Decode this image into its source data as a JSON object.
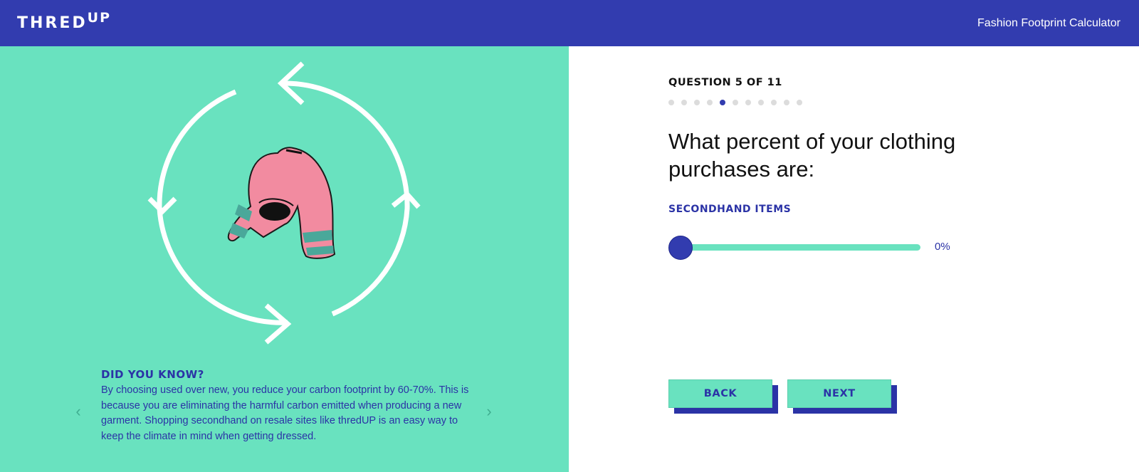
{
  "header": {
    "logo_main": "THRED",
    "logo_super": "UP",
    "app_title": "Fashion Footprint Calculator"
  },
  "colors": {
    "brand_blue": "#323caf",
    "mint": "#69e2bf",
    "sweater_pink": "#f28ba0"
  },
  "illustration": {
    "cycle_arrows": "recycle-cycle-arrows",
    "item": "pink-sweater-illustration"
  },
  "did_you_know": {
    "title": "DID YOU KNOW?",
    "body": "By choosing used over new, you reduce your carbon footprint by 60-70%. This is because you are eliminating the harmful carbon emitted when producing a new garment. Shopping secondhand on resale sites like thredUP is an easy way to keep the climate in mind when getting dressed.",
    "prev_icon": "chevron-left-icon",
    "next_icon": "chevron-right-icon",
    "prev_glyph": "‹",
    "next_glyph": "›"
  },
  "quiz": {
    "counter": "QUESTION 5 OF 11",
    "total_questions": 11,
    "current_question": 5,
    "question": "What percent of your clothing purchases are:",
    "section_label": "SECONDHAND ITEMS",
    "slider_value": 0,
    "slider_value_label": "0%"
  },
  "buttons": {
    "back": "BACK",
    "next": "NEXT"
  }
}
